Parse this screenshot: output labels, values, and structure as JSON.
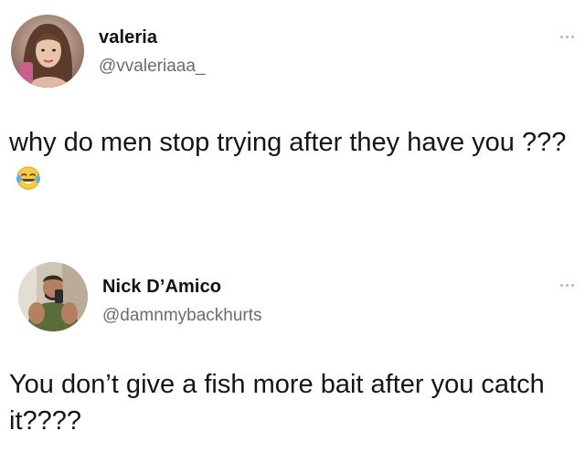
{
  "tweets": [
    {
      "name": "valeria",
      "handle": "@vvaleriaaa_",
      "text": "why do men stop trying after they have you ???",
      "emoji": "face-with-tears-of-joy",
      "avatar": "avatar-photo-valeria"
    },
    {
      "name": "Nick D’Amico",
      "handle": "@damnmybackhurts",
      "text": "You don’t give a fish more bait after you catch it????",
      "avatar": "avatar-photo-nick"
    }
  ],
  "icons": {
    "more": "more-options-icon"
  },
  "colors": {
    "name": "#111111",
    "handle": "#6c6c6c",
    "text": "#151515",
    "background": "#ffffff"
  }
}
